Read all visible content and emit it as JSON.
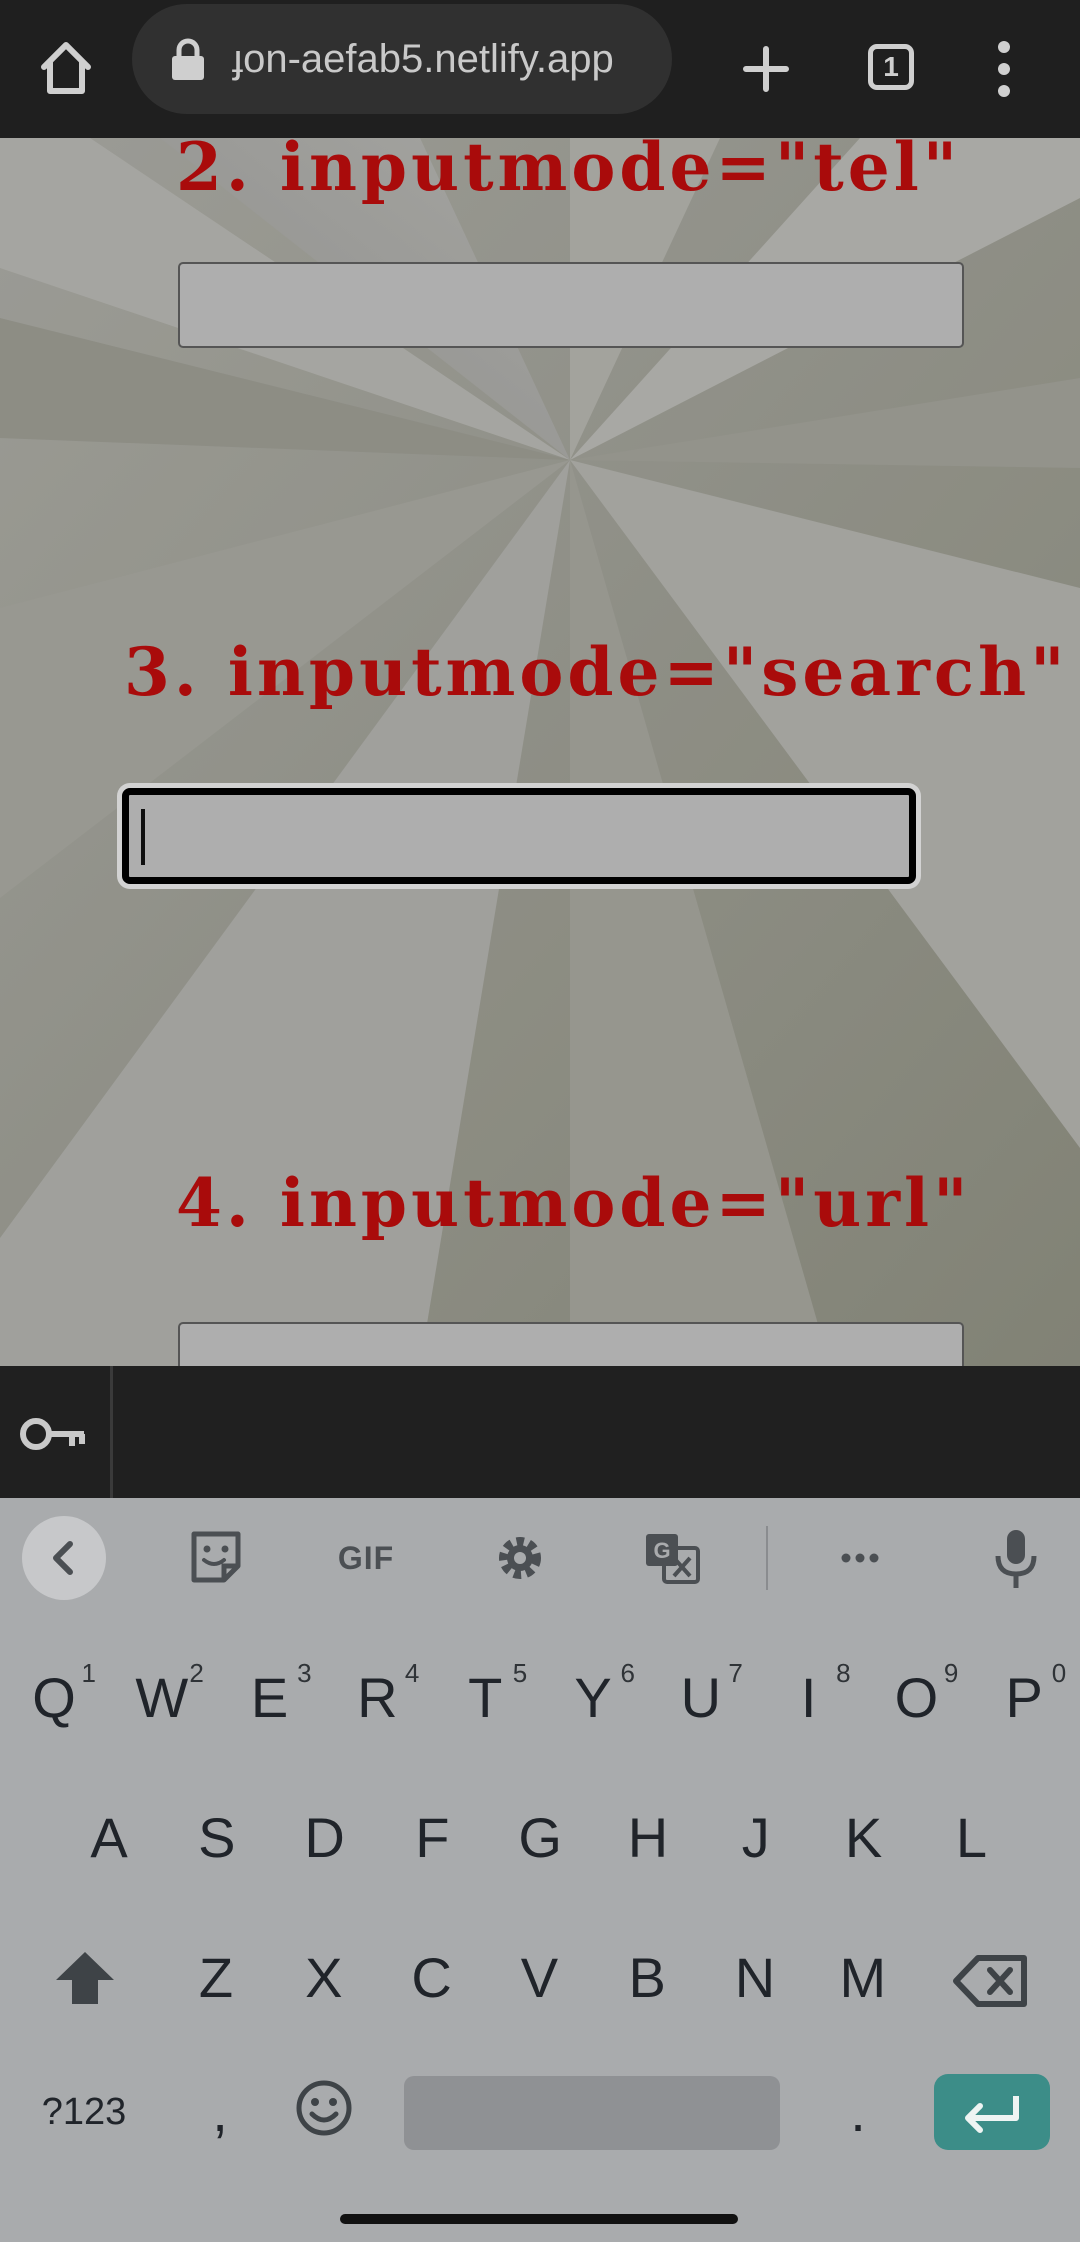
{
  "browser": {
    "url": "ɟon-aefab5.netlify.app",
    "tab_count": "1"
  },
  "page": {
    "sections": [
      {
        "title": "2. inputmode=\"tel\"",
        "value": ""
      },
      {
        "title": "3. inputmode=\"search\"",
        "value": ""
      },
      {
        "title": "4. inputmode=\"url\"",
        "value": ""
      }
    ],
    "focused_section": 1
  },
  "keyboard": {
    "toolbar": [
      "back-arrow",
      "sticker",
      "GIF",
      "settings",
      "translate",
      "more",
      "microphone"
    ],
    "gif_label": "GIF",
    "row1": [
      {
        "key": "Q",
        "hint": "1"
      },
      {
        "key": "W",
        "hint": "2"
      },
      {
        "key": "E",
        "hint": "3"
      },
      {
        "key": "R",
        "hint": "4"
      },
      {
        "key": "T",
        "hint": "5"
      },
      {
        "key": "Y",
        "hint": "6"
      },
      {
        "key": "U",
        "hint": "7"
      },
      {
        "key": "I",
        "hint": "8"
      },
      {
        "key": "O",
        "hint": "9"
      },
      {
        "key": "P",
        "hint": "0"
      }
    ],
    "row2": [
      "A",
      "S",
      "D",
      "F",
      "G",
      "H",
      "J",
      "K",
      "L"
    ],
    "row3": [
      "Z",
      "X",
      "C",
      "V",
      "B",
      "N",
      "M"
    ],
    "symbols_label": "?123",
    "comma": ",",
    "period": ".",
    "enter_color": "#3c8d88"
  },
  "colors": {
    "title_red": "#b80d0d",
    "field_gray": "#bdbdbd",
    "keyboard_bg": "#a9abad"
  }
}
